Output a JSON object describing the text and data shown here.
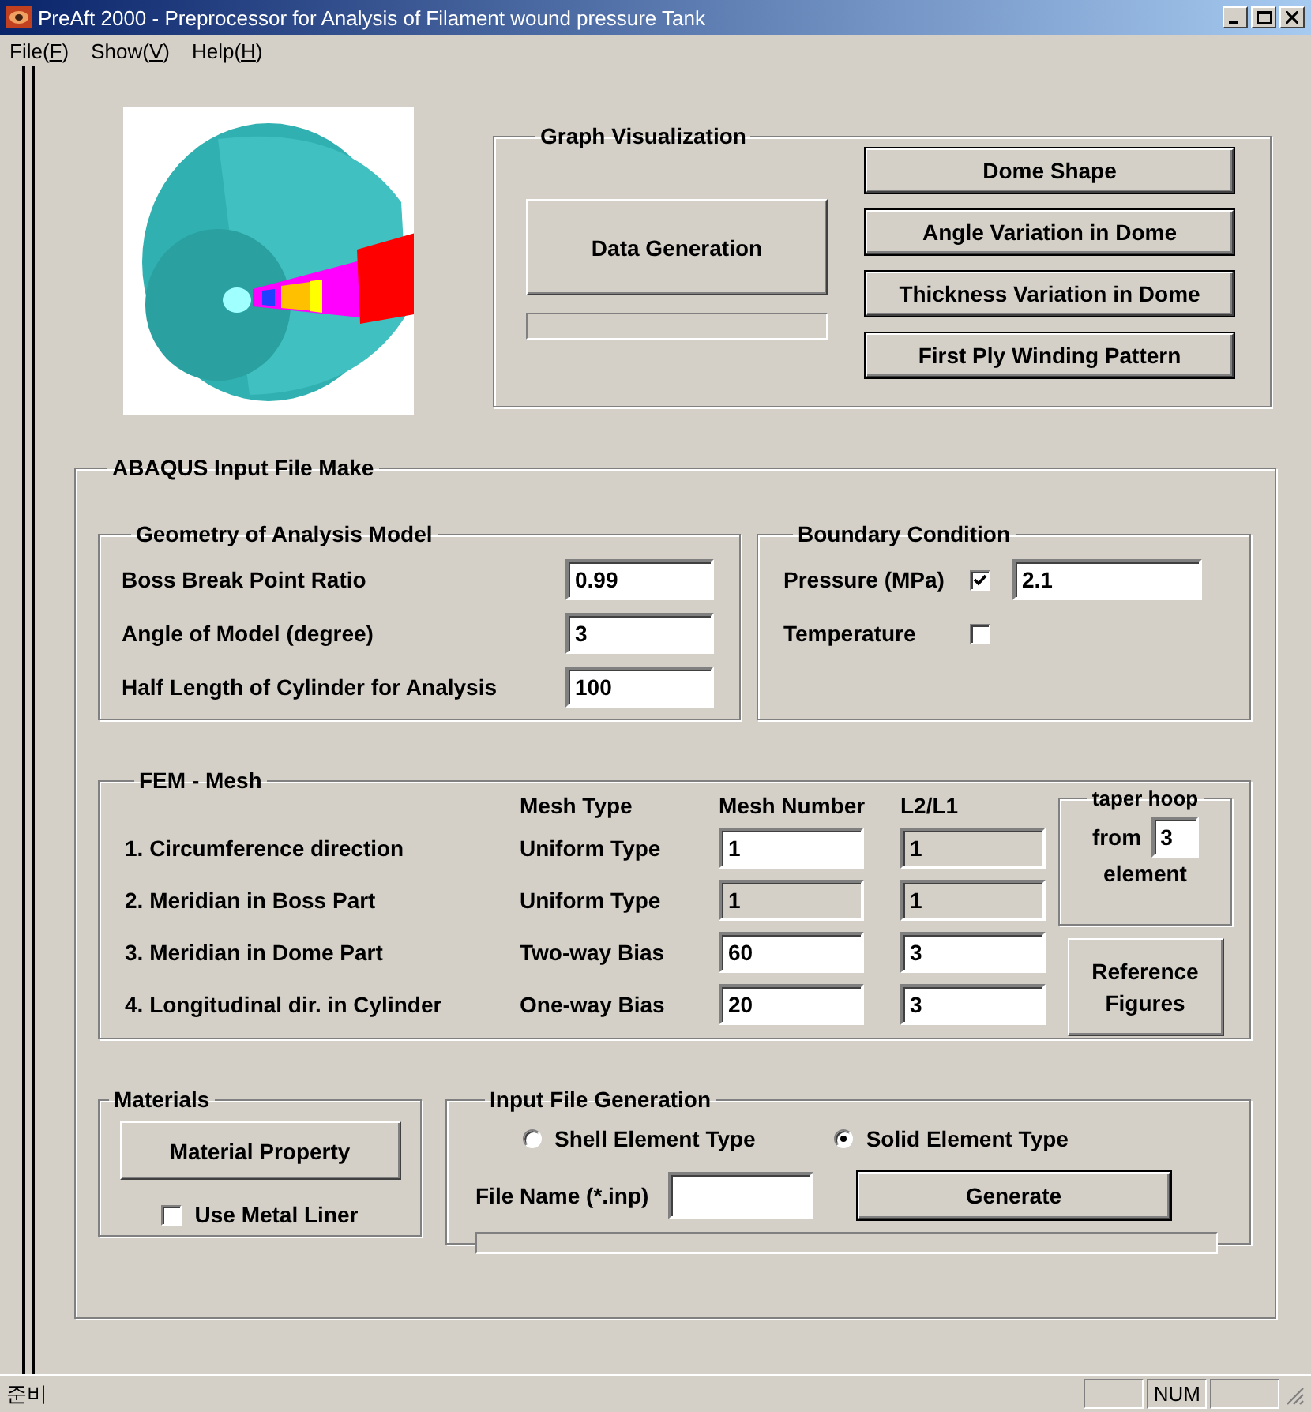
{
  "window": {
    "title": "PreAft 2000 - Preprocessor for Analysis of Filament wound pressure Tank"
  },
  "menu": [
    {
      "before": "File(",
      "accel": "F",
      "after": ")"
    },
    {
      "before": "Show(",
      "accel": "V",
      "after": ")"
    },
    {
      "before": "Help(",
      "accel": "H",
      "after": ")"
    }
  ],
  "graph_visualization": {
    "title": "Graph Visualization",
    "data_button": "Data Generation",
    "progress": {
      "level": 0
    },
    "buttons": [
      "Dome Shape",
      "Angle Variation in Dome",
      "Thickness Variation in Dome",
      "First Ply Winding Pattern"
    ]
  },
  "abaqus": {
    "title": "ABAQUS Input File Make",
    "geometry": {
      "title": "Geometry of Analysis Model",
      "fields": [
        {
          "label": "Boss Break Point Ratio",
          "value": "0.99"
        },
        {
          "label": "Angle of Model (degree)",
          "value": "3"
        },
        {
          "label": "Half Length of Cylinder for Analysis",
          "value": "100"
        }
      ]
    },
    "boundary": {
      "title": "Boundary Condition",
      "rows": [
        {
          "label": "Pressure (MPa)",
          "checked": true,
          "value": "2.1"
        },
        {
          "label": "Temperature",
          "checked": false
        }
      ]
    },
    "fem_mesh": {
      "title": "FEM - Mesh",
      "columns": [
        "Mesh Type",
        "Mesh Number",
        "L2/L1"
      ],
      "rows": [
        {
          "label": "1. Circumference direction",
          "mesh_type": "Uniform Type",
          "mesh_number": {
            "value": "1",
            "disabled": false
          },
          "ratio": {
            "value": "1",
            "disabled": true
          }
        },
        {
          "label": "2. Meridian in Boss Part",
          "mesh_type": "Uniform Type",
          "mesh_number": {
            "value": "1",
            "disabled": true
          },
          "ratio": {
            "value": "1",
            "disabled": true
          }
        },
        {
          "label": "3. Meridian in Dome Part",
          "mesh_type": "Two-way Bias",
          "mesh_number": {
            "value": "60",
            "disabled": false
          },
          "ratio": {
            "value": "3",
            "disabled": false
          }
        },
        {
          "label": "4. Longitudinal dir. in Cylinder",
          "mesh_type": "One-way Bias",
          "mesh_number": {
            "value": "20",
            "disabled": false
          },
          "ratio": {
            "value": "3",
            "disabled": false
          }
        }
      ],
      "taper": {
        "title": "taper hoop",
        "before": "from",
        "value": "3",
        "after": "element"
      },
      "reference_button": "Reference Figures"
    },
    "materials": {
      "title": "Materials",
      "button": "Material Property",
      "liner": {
        "label": "Use Metal Liner",
        "checked": false
      }
    },
    "input_file": {
      "title": "Input File Generation",
      "element_types": [
        {
          "label": "Shell Element Type",
          "selected": false
        },
        {
          "label": "Solid Element Type",
          "selected": true
        }
      ],
      "file_name": {
        "label": "File Name (*.inp)"
      },
      "generate_button": "Generate",
      "progress": {
        "level": 0
      }
    }
  },
  "status_bar": {
    "text": "준비",
    "indicators": [
      "NUM"
    ]
  }
}
